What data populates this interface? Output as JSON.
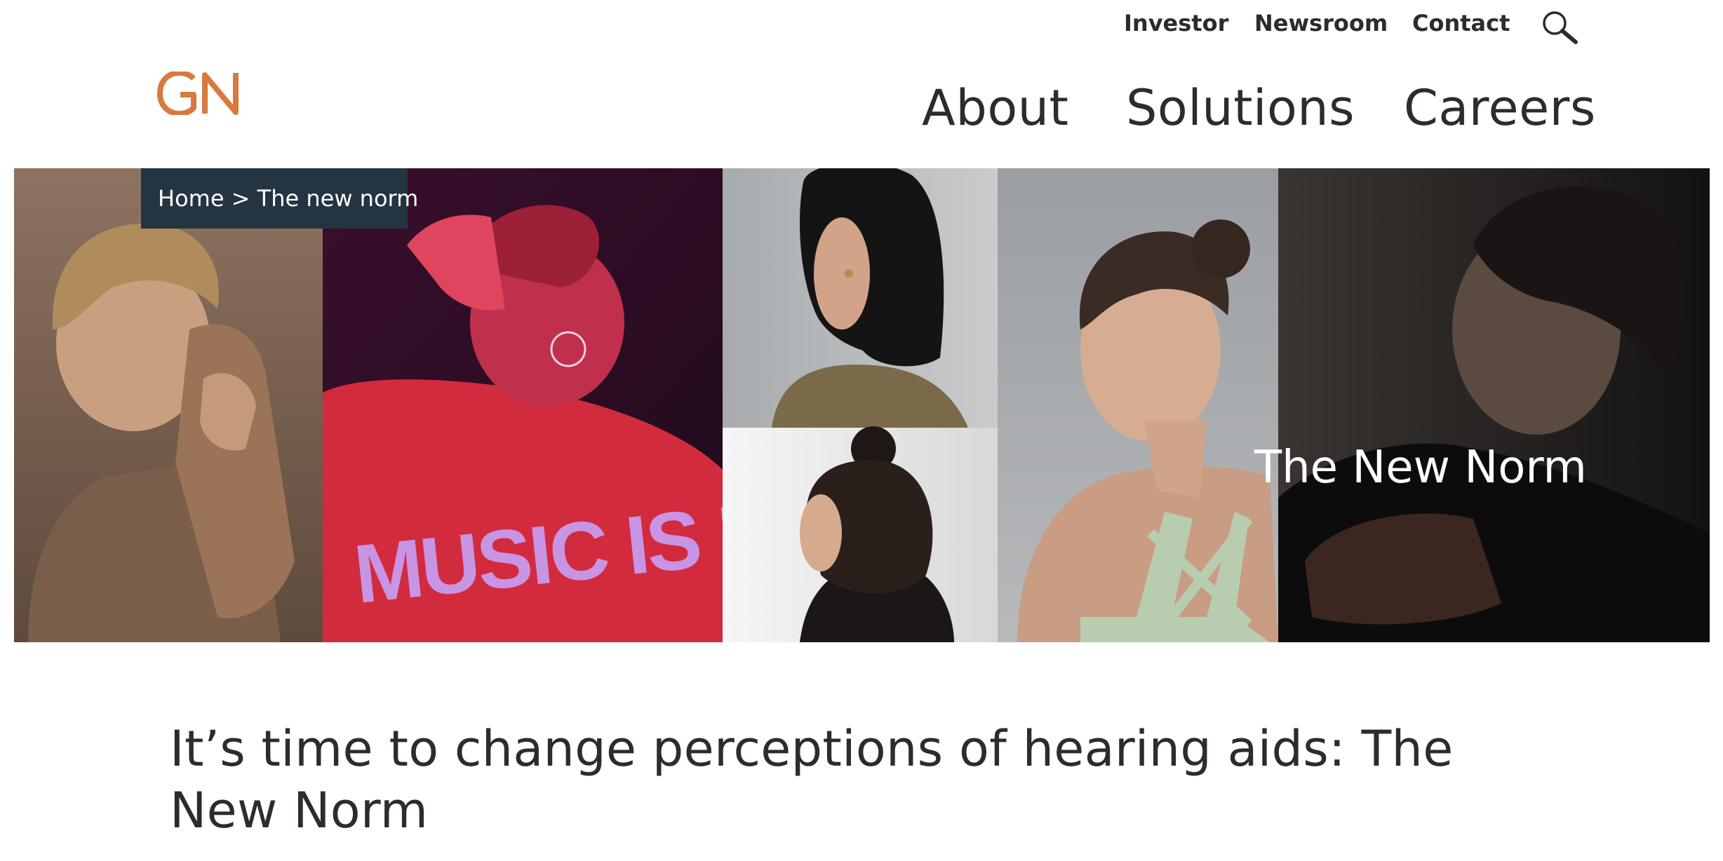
{
  "utility_nav": {
    "investor": "Investor",
    "newsroom": "Newsroom",
    "contact": "Contact",
    "search_icon": "search-icon"
  },
  "logo": {
    "text": "GN",
    "color": "#d87a3d"
  },
  "main_nav": {
    "about": "About",
    "solutions": "Solutions",
    "careers": "Careers"
  },
  "hero": {
    "breadcrumb": "Home > The new norm",
    "title": "The New Norm",
    "jacket_text": "MUSIC IS LOVE"
  },
  "article": {
    "heading": "It’s time to change perceptions of hearing aids: The New Norm"
  },
  "colors": {
    "text": "#2f2a2b",
    "breadcrumb_bg": "#253441",
    "brand_orange": "#d87a3d"
  }
}
